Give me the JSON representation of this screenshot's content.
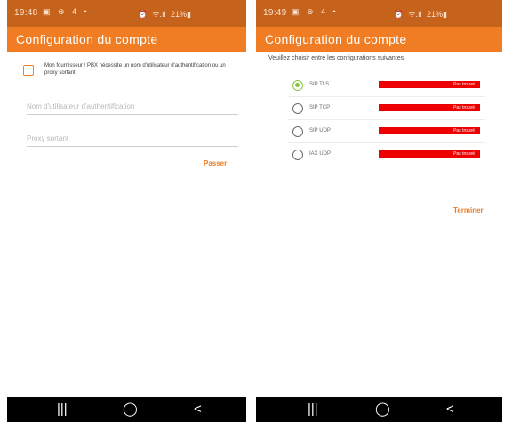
{
  "left": {
    "status_bar": {
      "time": "19:48",
      "left_icons": "▣ ⊗ 4 •",
      "alarm": "⏰",
      "signal": "ᯤ.ıl",
      "battery": "21%▮"
    },
    "title": "Configuration du compte",
    "checkbox_label": "Mon fournisseur / PBX nécessite un nom d'utilisateur d'authentification ou un proxy sortant",
    "checkbox_checked": false,
    "auth_username": {
      "value": "",
      "placeholder": "Nom d'utilisateur d'authentification"
    },
    "proxy": {
      "value": "",
      "placeholder": "Proxy sortant"
    },
    "skip_label": "Passer",
    "nav": {
      "recents": "|||",
      "home": "◯",
      "back": "<"
    }
  },
  "right": {
    "status_bar": {
      "time": "19:49",
      "left_icons": "▣ ⊗ 4 •",
      "alarm": "⏰",
      "signal": "ᯤ.ıl",
      "battery": "21%▮"
    },
    "title": "Configuration du compte",
    "instruction": "Veuillez choisir entre les configurations suivantes",
    "options": [
      {
        "label": "SIP TLS",
        "selected": true,
        "status": "Pas trouvé"
      },
      {
        "label": "SIP TCP",
        "selected": false,
        "status": "Pas trouvé"
      },
      {
        "label": "SIP UDP",
        "selected": false,
        "status": "Pas trouvé"
      },
      {
        "label": "IAX UDP",
        "selected": false,
        "status": "Pas trouvé"
      }
    ],
    "finish_label": "Terminer",
    "nav": {
      "recents": "|||",
      "home": "◯",
      "back": "<"
    }
  },
  "colors": {
    "status_bar": "#c5621c",
    "app_bar": "#f07d24",
    "accent": "#f07d24",
    "radio_selected": "#8ac43c",
    "not_found": "#ee0000",
    "nav_bar": "#000000"
  }
}
